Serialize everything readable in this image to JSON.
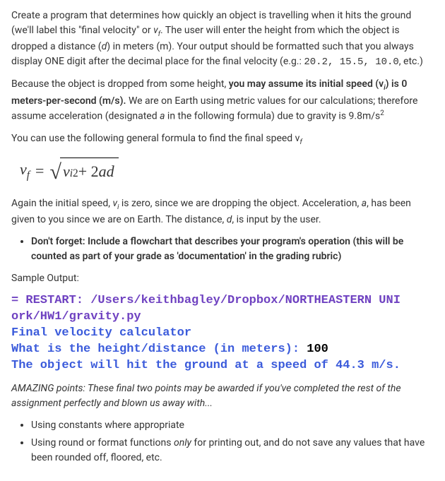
{
  "p1_a": "Create a program that determines how quickly an object is travelling when it hits the ground (we'll label this \"final velocity\" or ",
  "p1_vf": "v",
  "p1_vf_sub": "f",
  "p1_b": ". The user will enter the height from which the object is dropped a distance (",
  "p1_d": "d",
  "p1_c": ") in meters (m). Your output should be formatted such that you always display ONE digit after the decimal place for the final velocity (e.g.: ",
  "p1_code": "20.2, 15.5, 10.0",
  "p1_d2": ", etc.)",
  "p2_a": "Because the object is dropped from some height, ",
  "p2_bold": "you may assume its initial speed (v",
  "p2_bold_sub": "i",
  "p2_bold2": ") is 0 meters-per-second (m/s).",
  "p2_b": " We are on Earth using metric values for our calculations; therefore assume acceleration (designated ",
  "p2_a_var": "a",
  "p2_c": " in the following formula) due to gravity is 9.8m/s",
  "p2_sup": "2",
  "p3": "You can use the following general formula to find the final speed v",
  "p3_sub": "f",
  "formula": {
    "lhs_v": "v",
    "lhs_sub": "f",
    "eq": "=",
    "r_v": "v",
    "r_sub": "i",
    "r_sup": "2",
    "plus": " + 2",
    "a": "a",
    "d": "d"
  },
  "p4_a": "Again the initial speed, ",
  "p4_vi": "v",
  "p4_vi_sub": "i",
  "p4_b": " is zero, since we are dropping the object. Acceleration, ",
  "p4_a_var": "a",
  "p4_c": ", has been given to you since we are on Earth. The distance, ",
  "p4_d_var": "d",
  "p4_d": ", is input by the user.",
  "bullet1": "Don't forget: Include a flowchart that describes your program's operation (this will be counted as part of your grade as 'documentation' in the grading rubric)",
  "sample_label": "Sample Output:",
  "out_l1a": "= ",
  "out_l1b": "RESTART: /Users/keithbagley/Dropbox/NORTHEASTERN UNI",
  "out_l2": "ork/HW1/gravity.py",
  "out_l3": "Final velocity calculator",
  "out_l4a": "What is the height/distance (in meters): ",
  "out_l4b": "100",
  "out_l5": "The object will hit the ground at a speed of 44.3 m/s.",
  "amazing": "AMAZING points: These final two points may be awarded if you've completed the rest of the assignment perfectly and blown us away with...",
  "bp1": "Using constants where appropriate",
  "bp2_a": "Using round or format functions ",
  "bp2_i": "only",
  "bp2_b": " for printing out, and do not save any values that have been rounded off, floored, etc."
}
